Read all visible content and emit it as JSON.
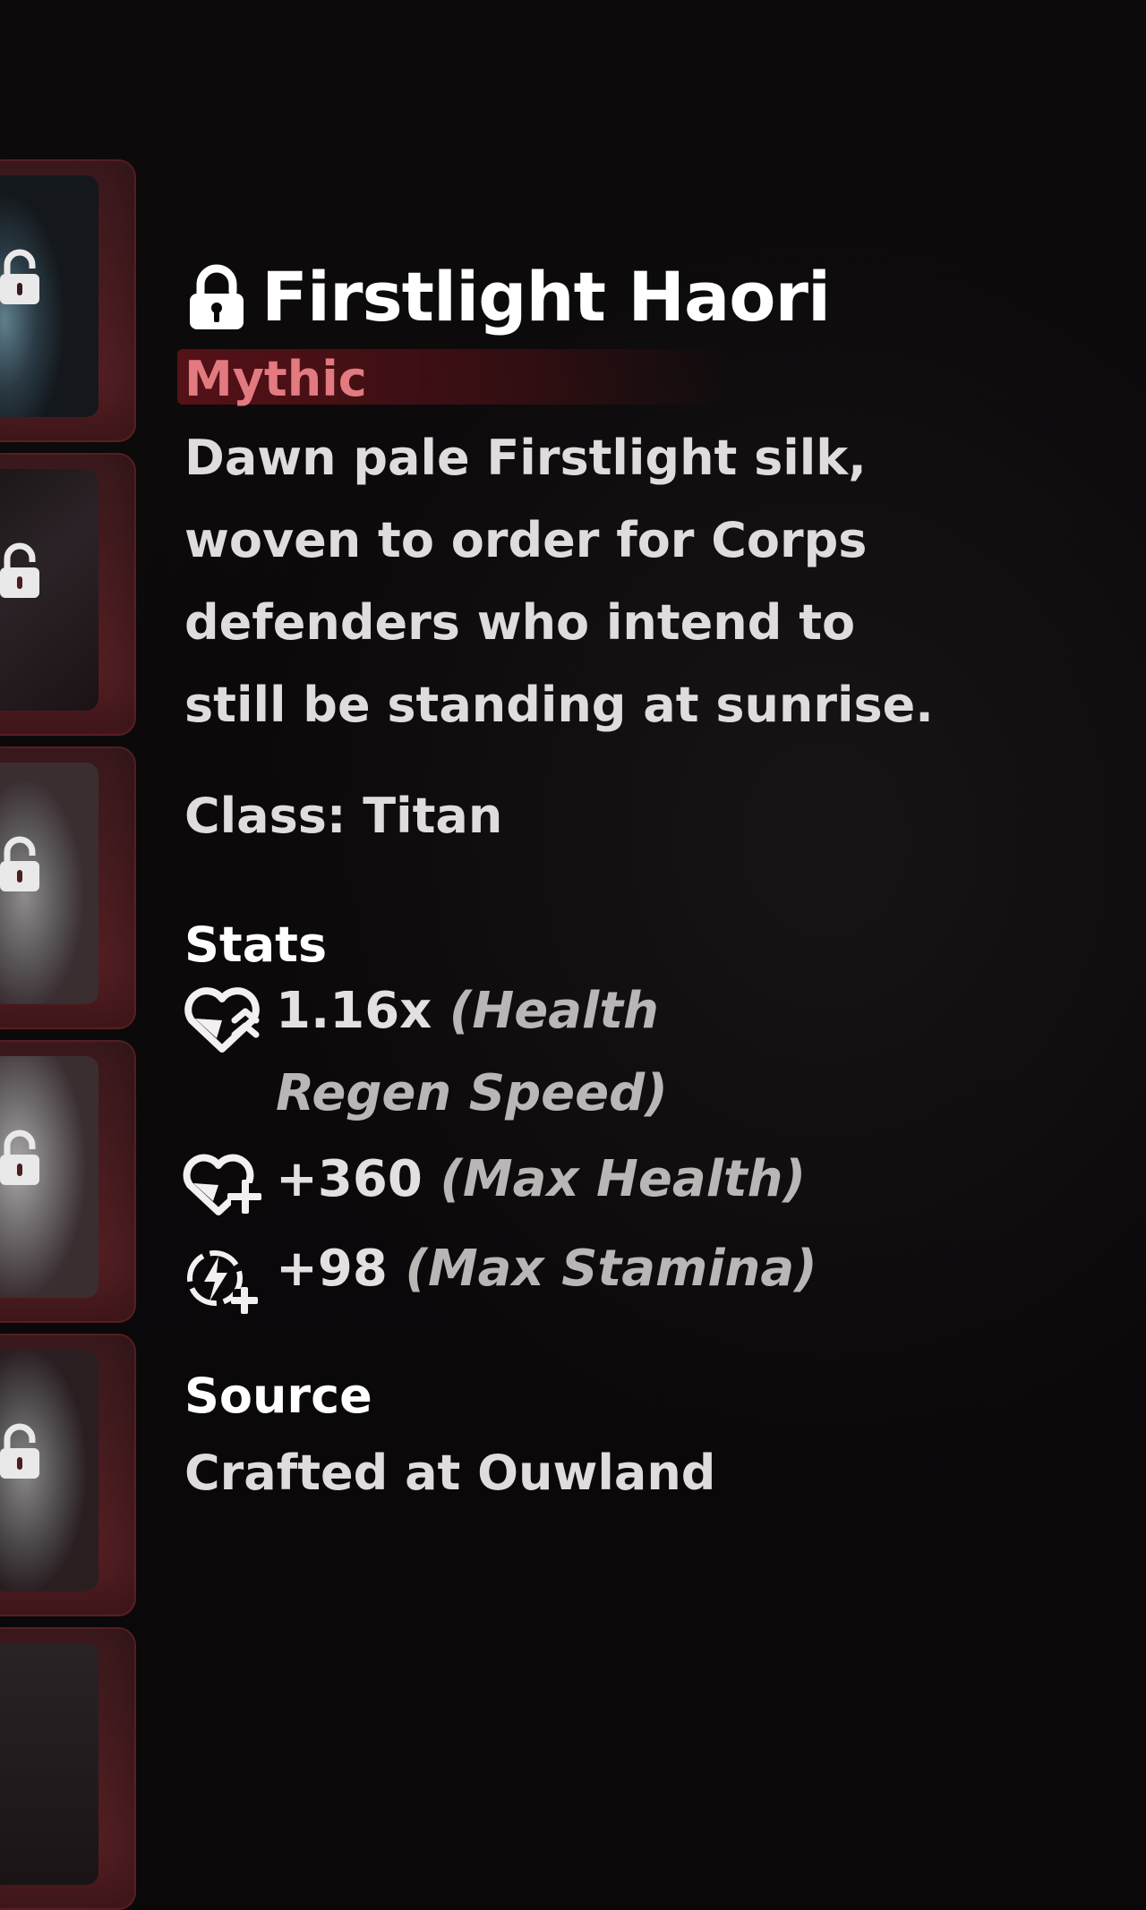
{
  "item": {
    "name": "Firstlight Haori",
    "rarity": "Mythic",
    "description": "Dawn pale Firstlight silk, woven to order for Corps defenders who intend to still be standing at sunrise.",
    "class_line": "Class: Titan",
    "stats_heading": "Stats",
    "stats": [
      {
        "icon": "heart-regen-icon",
        "value": "1.16x",
        "label": "(Health Regen Speed)"
      },
      {
        "icon": "heart-plus-icon",
        "value": "+360",
        "label": "(Max Health)"
      },
      {
        "icon": "stamina-plus-icon",
        "value": "+98",
        "label": "(Max Stamina)"
      }
    ],
    "source_heading": "Source",
    "source_value": "Crafted at Ouwland"
  },
  "slots": [
    {
      "icon": "lock-icon",
      "locked": true
    },
    {
      "icon": "lock-icon",
      "locked": true
    },
    {
      "icon": "lock-icon",
      "locked": true
    },
    {
      "icon": "lock-icon",
      "locked": true
    },
    {
      "icon": "lock-icon",
      "locked": true
    },
    {
      "icon": "lock-icon",
      "locked": true
    }
  ],
  "colors": {
    "background": "#0a0809",
    "slot": "#4c1d21",
    "rarity_text": "#e27a7f",
    "rarity_glow": "#6e141c",
    "title": "#ffffff",
    "body_text": "#dedcdc",
    "stat_label": "#b9b6b6"
  }
}
